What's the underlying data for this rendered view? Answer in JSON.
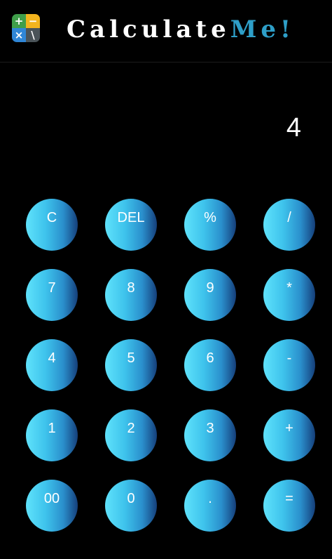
{
  "header": {
    "app_icon": {
      "name": "calculator-app-icon",
      "glyphs": [
        "+",
        "−",
        "×",
        "\\"
      ],
      "colors": [
        "#3f9e4a",
        "#f3b41d",
        "#2f86d6",
        "#4a5358"
      ]
    },
    "title_main": "Calculate",
    "title_accent": "Me!",
    "title_accent_color": "#2e9fc8"
  },
  "display": {
    "value": "4"
  },
  "keypad": {
    "rows": [
      [
        "C",
        "DEL",
        "%",
        "/"
      ],
      [
        "7",
        "8",
        "9",
        "*"
      ],
      [
        "4",
        "5",
        "6",
        "-"
      ],
      [
        "1",
        "2",
        "3",
        "+"
      ],
      [
        "00",
        "0",
        ".",
        "="
      ]
    ]
  },
  "colors": {
    "background": "#000000",
    "key_gradient_light": "#5fe2fb",
    "key_gradient_dark": "#153f7a"
  }
}
